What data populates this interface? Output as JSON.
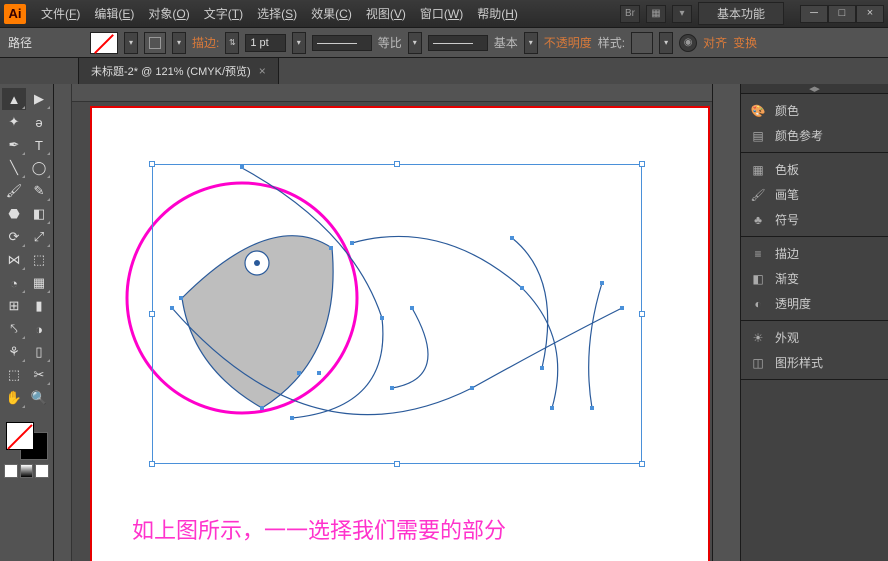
{
  "menubar": {
    "items": [
      {
        "label": "文件",
        "key": "F"
      },
      {
        "label": "编辑",
        "key": "E"
      },
      {
        "label": "对象",
        "key": "O"
      },
      {
        "label": "文字",
        "key": "T"
      },
      {
        "label": "选择",
        "key": "S"
      },
      {
        "label": "效果",
        "key": "C"
      },
      {
        "label": "视图",
        "key": "V"
      },
      {
        "label": "窗口",
        "key": "W"
      },
      {
        "label": "帮助",
        "key": "H"
      }
    ],
    "workspace": "基本功能"
  },
  "controlbar": {
    "context": "路径",
    "stroke_label": "描边:",
    "stroke_weight": "1 pt",
    "profile_label": "等比",
    "brush_label": "基本",
    "opacity_label": "不透明度",
    "style_label": "样式:",
    "align_label": "对齐",
    "transform_label": "变换"
  },
  "document": {
    "tab_title": "未标题-2* @ 121% (CMYK/预览)"
  },
  "canvas": {
    "caption": "如上图所示，一一选择我们需要的部分"
  },
  "panels": {
    "group1": [
      {
        "icon": "palette",
        "label": "颜色"
      },
      {
        "icon": "guide",
        "label": "颜色参考"
      }
    ],
    "group2": [
      {
        "icon": "swatches",
        "label": "色板"
      },
      {
        "icon": "brushes",
        "label": "画笔"
      },
      {
        "icon": "symbols",
        "label": "符号"
      }
    ],
    "group3": [
      {
        "icon": "stroke",
        "label": "描边"
      },
      {
        "icon": "gradient",
        "label": "渐变"
      },
      {
        "icon": "transparency",
        "label": "透明度"
      }
    ],
    "group4": [
      {
        "icon": "appearance",
        "label": "外观"
      },
      {
        "icon": "graphic-styles",
        "label": "图形样式"
      }
    ]
  }
}
